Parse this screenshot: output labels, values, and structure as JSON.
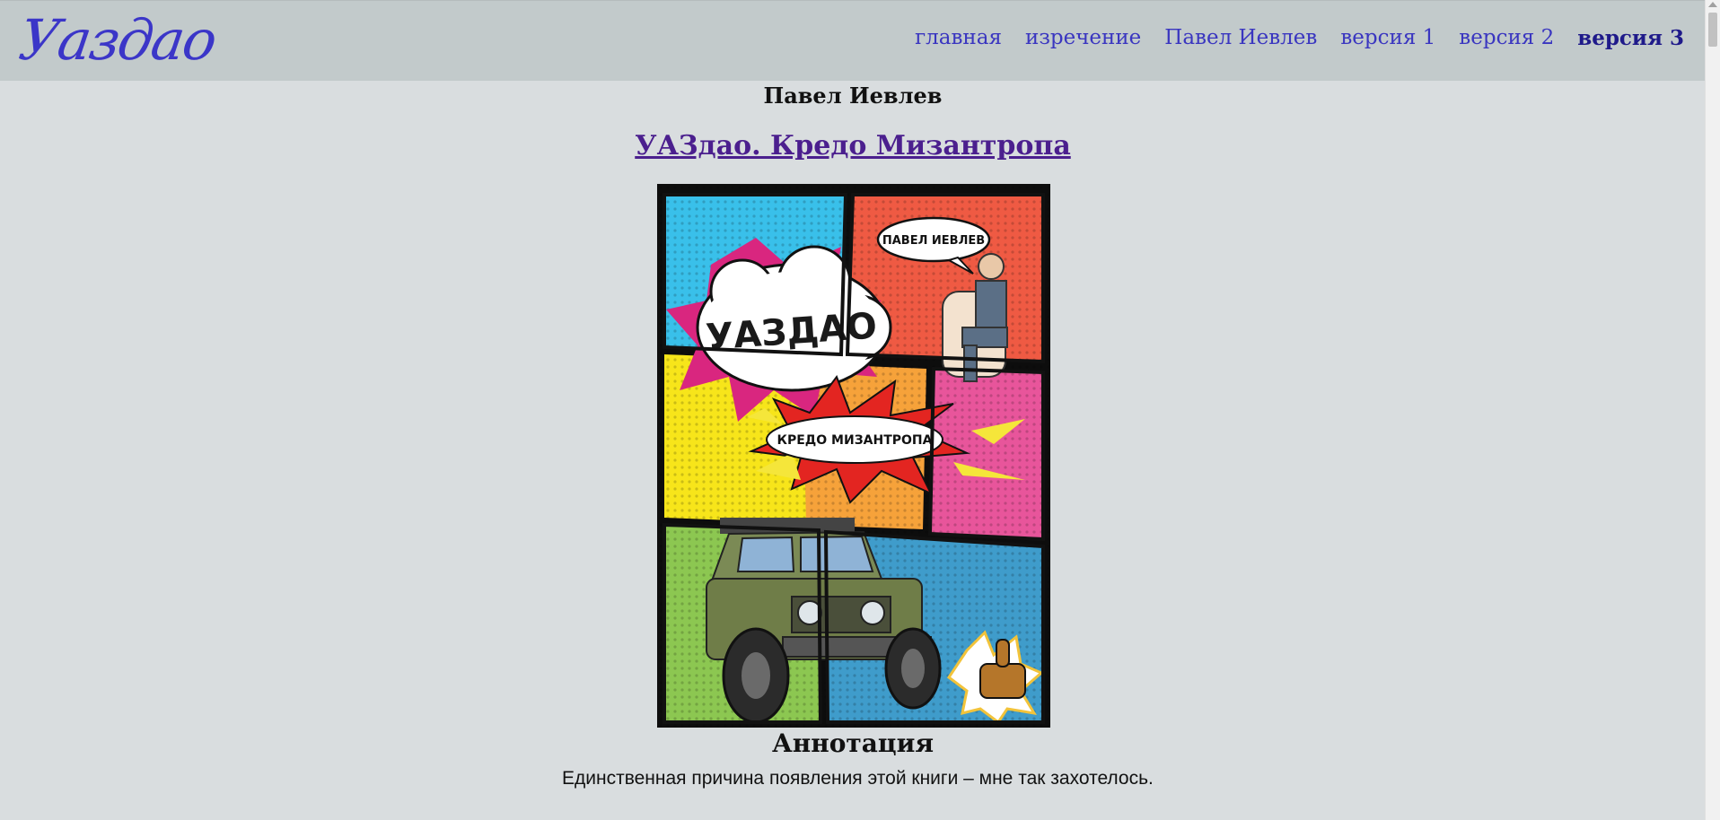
{
  "site": {
    "logo": "Уаздао"
  },
  "nav": {
    "items": [
      {
        "label": "главная"
      },
      {
        "label": "изречение"
      },
      {
        "label": "Павел Иевлев"
      },
      {
        "label": "версия 1"
      },
      {
        "label": "версия 2"
      },
      {
        "label": "версия 3",
        "active": true
      }
    ]
  },
  "main": {
    "author": "Павел Иевлев",
    "book_title": "УАЗдао. Кредо Мизантропа",
    "cover": {
      "author_bubble": "ПАВЕЛ ИЕВЛЕВ",
      "title_bubble": "УАЗДАО",
      "subtitle_bubble": "КРЕДО МИЗАНТРОПА"
    },
    "annotation_heading": "Аннотация",
    "annotation_text": "Единственная причина появления этой книги – мне так захотелось."
  },
  "colors": {
    "nav_link": "#3a36c0",
    "title_link": "#4b1f8e",
    "background": "#d9dddf",
    "navbar": "#c2cacb"
  }
}
